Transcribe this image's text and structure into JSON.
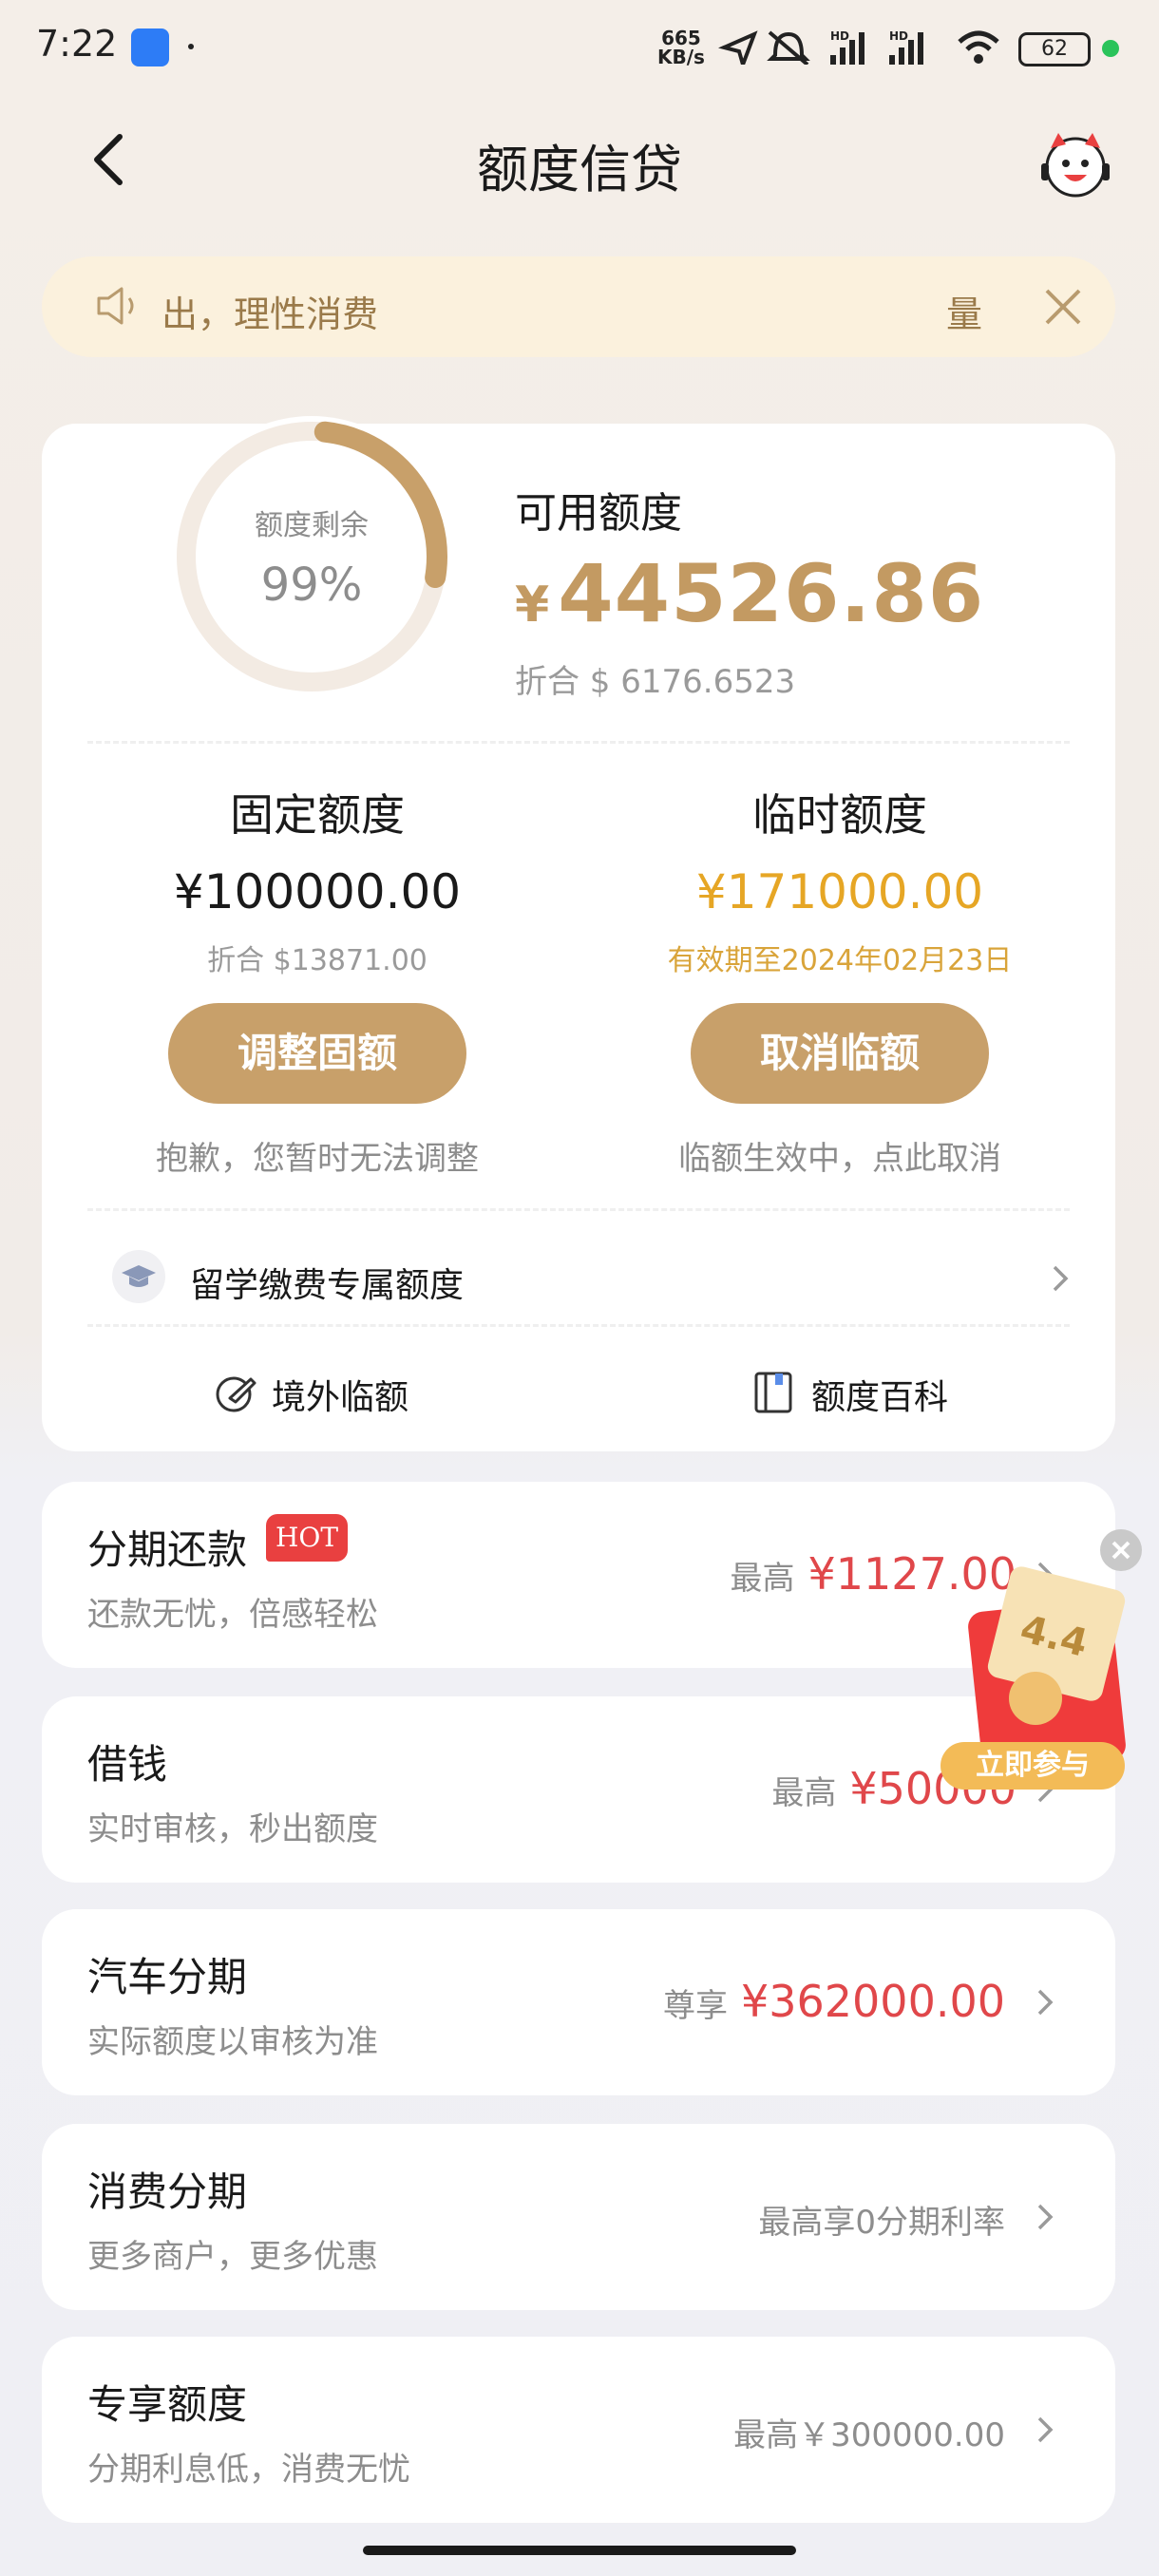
{
  "status_bar": {
    "time": "7:22",
    "speed_top": "665",
    "speed_bottom": "KB/s",
    "battery": "62"
  },
  "header": {
    "title": "额度信贷"
  },
  "notice": {
    "text": "出，理性消费",
    "text_tail": "量"
  },
  "credit": {
    "gauge_label": "额度剩余",
    "gauge_percent_display": "99%",
    "gauge_fraction": 0.99,
    "available_label": "可用额度",
    "available_currency": "¥",
    "available_amount": "44526.86",
    "available_converted": "折合 $ 6176.6523"
  },
  "fixed": {
    "title": "固定额度",
    "amount": "¥100000.00",
    "converted": "折合 $13871.00",
    "button": "调整固额",
    "note": "抱歉，您暂时无法调整"
  },
  "temp": {
    "title": "临时额度",
    "amount": "¥171000.00",
    "validity": "有效期至2024年02月23日",
    "button": "取消临额",
    "note": "临额生效中，点此取消"
  },
  "study_abroad": {
    "label": "留学缴费专属额度"
  },
  "links": {
    "overseas": "境外临额",
    "wiki": "额度百科"
  },
  "items": [
    {
      "title": "分期还款",
      "badge": "HOT",
      "subtitle": "还款无忧，倍感轻松",
      "prefix": "最高",
      "value": "¥1127.00"
    },
    {
      "title": "借钱",
      "subtitle": "实时审核，秒出额度",
      "prefix": "最高",
      "value": "¥50000"
    },
    {
      "title": "汽车分期",
      "subtitle": "实际额度以审核为准",
      "prefix": "尊享",
      "value": "¥362000.00"
    },
    {
      "title": "消费分期",
      "subtitle": "更多商户，更多优惠",
      "value": "最高享0分期利率"
    },
    {
      "title": "专享额度",
      "subtitle": "分期利息低，消费无忧",
      "value": "最高￥300000.00"
    }
  ],
  "promo": {
    "label": "4.4",
    "button": "立即参与"
  },
  "colors": {
    "gold": "#c8a06a",
    "accent_red": "#e0474a",
    "temp_gold": "#e6a625"
  }
}
